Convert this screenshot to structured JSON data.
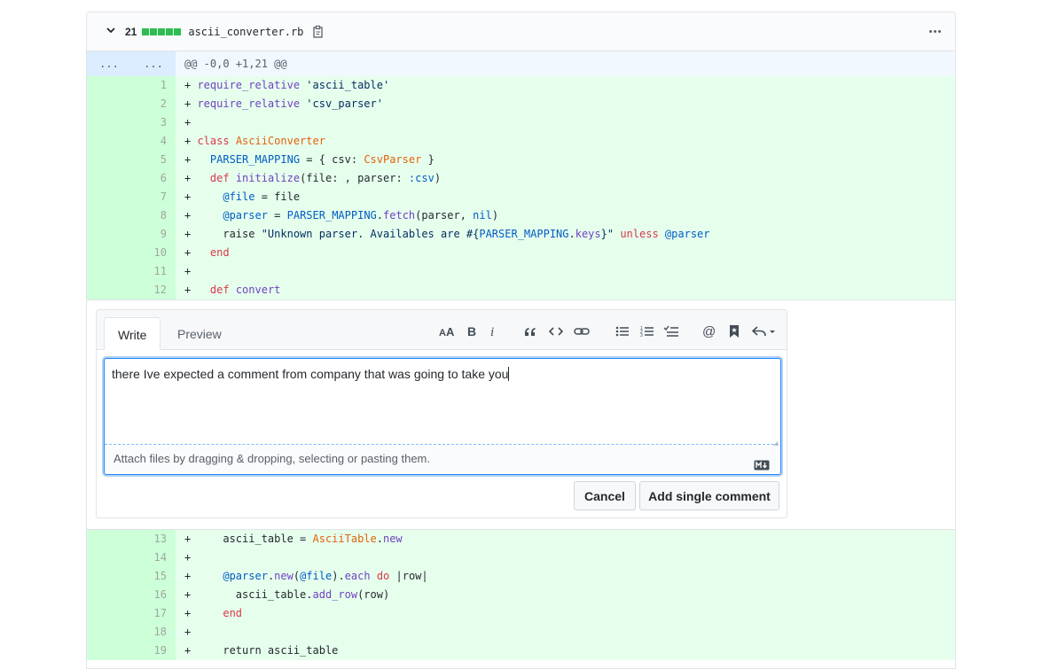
{
  "file": {
    "collapse_icon": "chevron-down-icon",
    "change_count": "21",
    "diffstat_colors": [
      "#2cbe4e",
      "#2cbe4e",
      "#2cbe4e",
      "#2cbe4e",
      "#2cbe4e"
    ],
    "name": "ascii_converter.rb",
    "copy_icon": "clipboard-icon",
    "more_icon": "kebab-horizontal-icon"
  },
  "hunk": {
    "expand_left": "...",
    "expand_right": "...",
    "header": "@@ -0,0 +1,21 @@"
  },
  "lines_top": [
    {
      "n": "1",
      "code": [
        [
          "p",
          "+ "
        ],
        [
          "fn",
          "require_relative"
        ],
        [
          "p",
          " "
        ],
        [
          "str",
          "'ascii_table'"
        ]
      ]
    },
    {
      "n": "2",
      "code": [
        [
          "p",
          "+ "
        ],
        [
          "fn",
          "require_relative"
        ],
        [
          "p",
          " "
        ],
        [
          "str",
          "'csv_parser'"
        ]
      ]
    },
    {
      "n": "3",
      "code": [
        [
          "p",
          "+"
        ]
      ]
    },
    {
      "n": "4",
      "code": [
        [
          "p",
          "+ "
        ],
        [
          "kw",
          "class"
        ],
        [
          "p",
          " "
        ],
        [
          "cls",
          "AsciiConverter"
        ]
      ]
    },
    {
      "n": "5",
      "code": [
        [
          "p",
          "+   "
        ],
        [
          "const",
          "PARSER_MAPPING"
        ],
        [
          "p",
          " = { csv: "
        ],
        [
          "cls",
          "CsvParser"
        ],
        [
          "p",
          " }"
        ]
      ]
    },
    {
      "n": "6",
      "code": [
        [
          "p",
          "+   "
        ],
        [
          "kw",
          "def"
        ],
        [
          "p",
          " "
        ],
        [
          "fn",
          "initialize"
        ],
        [
          "p",
          "(file: , parser: "
        ],
        [
          "const",
          ":csv"
        ],
        [
          "p",
          ")"
        ]
      ]
    },
    {
      "n": "7",
      "code": [
        [
          "p",
          "+     "
        ],
        [
          "const",
          "@file"
        ],
        [
          "p",
          " = file"
        ]
      ]
    },
    {
      "n": "8",
      "code": [
        [
          "p",
          "+     "
        ],
        [
          "const",
          "@parser"
        ],
        [
          "p",
          " = "
        ],
        [
          "const",
          "PARSER_MAPPING"
        ],
        [
          "p",
          "."
        ],
        [
          "fn",
          "fetch"
        ],
        [
          "p",
          "(parser, "
        ],
        [
          "const",
          "nil"
        ],
        [
          "p",
          ")"
        ]
      ]
    },
    {
      "n": "9",
      "code": [
        [
          "p",
          "+     raise "
        ],
        [
          "str",
          "\"Unknown parser. Availables are #{"
        ],
        [
          "const",
          "PARSER_MAPPING"
        ],
        [
          "p",
          "."
        ],
        [
          "fn",
          "keys"
        ],
        [
          "str",
          "}\""
        ],
        [
          "p",
          " "
        ],
        [
          "kw",
          "unless"
        ],
        [
          "p",
          " "
        ],
        [
          "const",
          "@parser"
        ]
      ]
    },
    {
      "n": "10",
      "code": [
        [
          "p",
          "+   "
        ],
        [
          "kw",
          "end"
        ]
      ]
    },
    {
      "n": "11",
      "code": [
        [
          "p",
          "+"
        ]
      ]
    },
    {
      "n": "12",
      "code": [
        [
          "p",
          "+   "
        ],
        [
          "kw",
          "def"
        ],
        [
          "p",
          " "
        ],
        [
          "fn",
          "convert"
        ]
      ]
    }
  ],
  "lines_bottom": [
    {
      "n": "13",
      "code": [
        [
          "p",
          "+     ascii_table = "
        ],
        [
          "cls",
          "AsciiTable"
        ],
        [
          "p",
          "."
        ],
        [
          "fn",
          "new"
        ]
      ]
    },
    {
      "n": "14",
      "code": [
        [
          "p",
          "+"
        ]
      ]
    },
    {
      "n": "15",
      "code": [
        [
          "p",
          "+     "
        ],
        [
          "const",
          "@parser"
        ],
        [
          "p",
          "."
        ],
        [
          "fn",
          "new"
        ],
        [
          "p",
          "("
        ],
        [
          "const",
          "@file"
        ],
        [
          "p",
          ")."
        ],
        [
          "fn",
          "each"
        ],
        [
          "p",
          " "
        ],
        [
          "kw",
          "do"
        ],
        [
          "p",
          " |row|"
        ]
      ]
    },
    {
      "n": "16",
      "code": [
        [
          "p",
          "+       ascii_table."
        ],
        [
          "fn",
          "add_row"
        ],
        [
          "p",
          "(row)"
        ]
      ]
    },
    {
      "n": "17",
      "code": [
        [
          "p",
          "+     "
        ],
        [
          "kw",
          "end"
        ]
      ]
    },
    {
      "n": "18",
      "code": [
        [
          "p",
          "+"
        ]
      ]
    },
    {
      "n": "19",
      "code": [
        [
          "p",
          "+     return ascii_table"
        ]
      ]
    }
  ],
  "comment": {
    "tabs": [
      "Write",
      "Preview"
    ],
    "toolbar_icons": [
      "text-size-icon",
      "bold-icon",
      "italic-icon",
      "quote-icon",
      "code-icon",
      "link-icon",
      "unordered-list-icon",
      "ordered-list-icon",
      "tasklist-icon",
      "mention-icon",
      "reference-icon",
      "reply-icon"
    ],
    "text": "there Ive expected a comment from company that was going to take you",
    "attach_hint": "Attach files by dragging & dropping, selecting or pasting them.",
    "markdown_icon": "markdown-icon",
    "cancel_label": "Cancel",
    "add_label": "Add single comment"
  }
}
